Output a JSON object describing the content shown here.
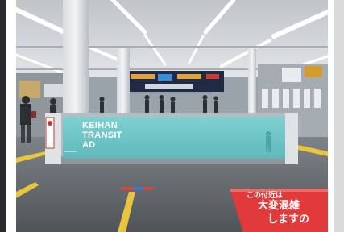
{
  "ad_banner": {
    "lines": [
      "KEIHAN",
      "TRANSIT",
      "AD"
    ],
    "color": "#6fc8c9"
  },
  "floor_sign": {
    "line1": "この付近は",
    "line2": "大変混雑",
    "line3": "しますの",
    "color": "#e23a3a"
  },
  "ceiling_signboard": {
    "color": "#1f2a44"
  }
}
